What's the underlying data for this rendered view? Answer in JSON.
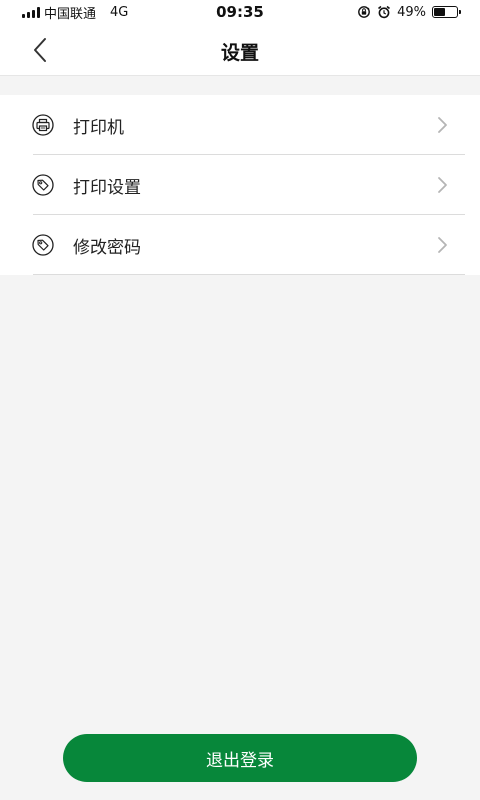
{
  "status_bar": {
    "carrier": "中国联通",
    "network": "4G",
    "time": "09:35",
    "battery": "49%",
    "battery_level": 0.49,
    "icons": [
      "signal-icon",
      "rotation-lock-icon",
      "alarm-icon",
      "battery-icon"
    ]
  },
  "nav": {
    "title": "设置",
    "back_icon": "back-arrow-icon"
  },
  "settings": {
    "items": [
      {
        "label": "打印机",
        "icon": "printer-icon"
      },
      {
        "label": "打印设置",
        "icon": "tag-icon"
      },
      {
        "label": "修改密码",
        "icon": "tag-icon"
      }
    ]
  },
  "logout": {
    "label": "退出登录"
  },
  "colors": {
    "accent": "#07873a",
    "background": "#f4f4f4",
    "surface": "#ffffff",
    "divider": "#dcdcdc"
  }
}
